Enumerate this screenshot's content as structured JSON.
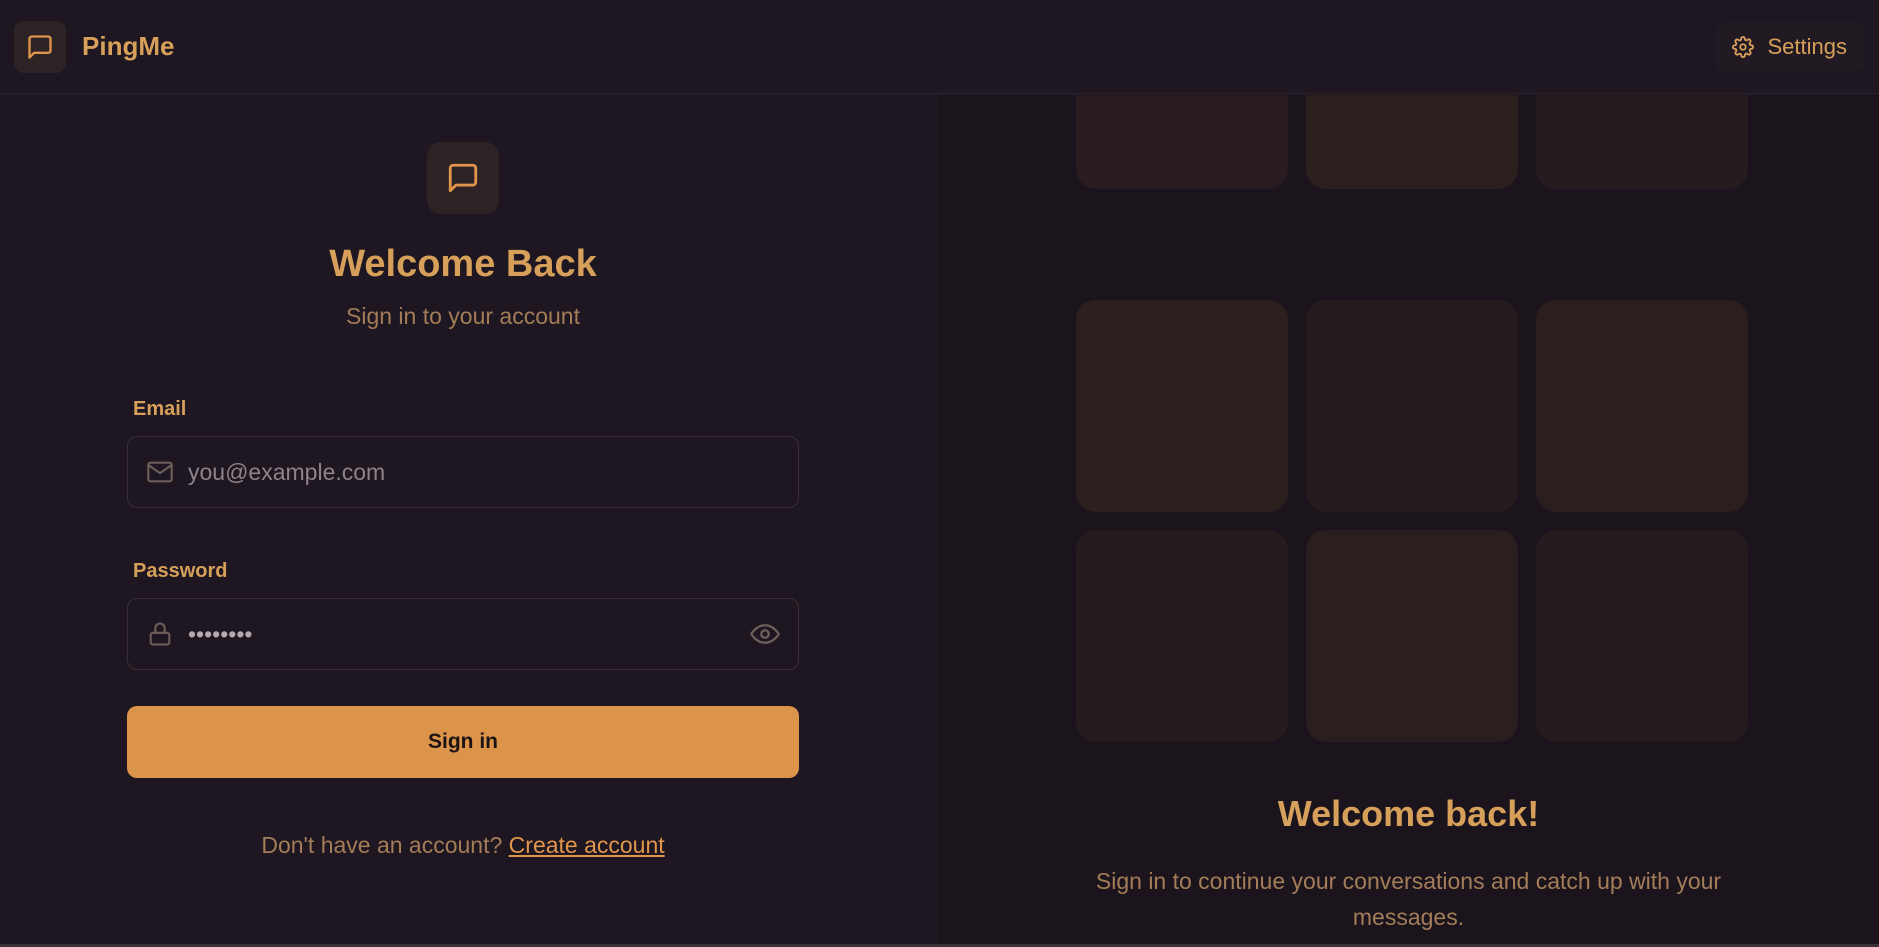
{
  "app": {
    "name": "PingMe"
  },
  "header": {
    "settings_label": "Settings"
  },
  "login": {
    "title": "Welcome Back",
    "subtitle": "Sign in to your account",
    "email_label": "Email",
    "email_placeholder": "you@example.com",
    "password_label": "Password",
    "password_value": "••••••••",
    "submit_label": "Sign in",
    "footer_prompt": "Don't have an account?",
    "footer_link": "Create account"
  },
  "promo": {
    "title": "Welcome back!",
    "subtitle": "Sign in to continue your conversations and catch up with your messages."
  },
  "icons": {
    "brand": "message-square-icon",
    "settings": "gear-icon",
    "email": "mail-icon",
    "password": "lock-icon",
    "toggle_password": "eye-icon"
  },
  "colors": {
    "background": "#1e1620",
    "accent": "#dc944b",
    "heading": "#d6a05a",
    "muted_text": "#a37d58"
  }
}
